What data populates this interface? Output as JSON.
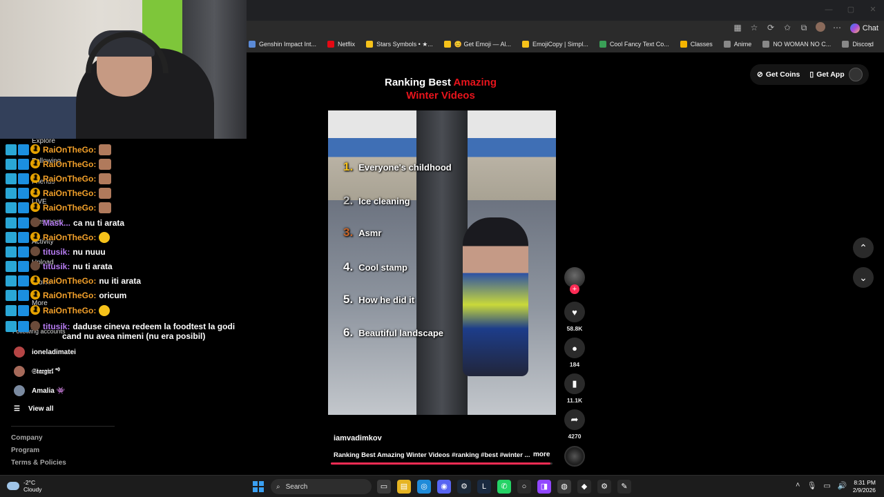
{
  "bookmarks": [
    {
      "label": "Genshin Impact Int...",
      "color": "#5b8ad6"
    },
    {
      "label": "Netflix",
      "color": "#e50914"
    },
    {
      "label": "Stars Symbols • ★...",
      "color": "#f6c21a"
    },
    {
      "label": "😊 Get Emoji — Al...",
      "color": "#f6c21a"
    },
    {
      "label": "EmojiCopy | Simpl...",
      "color": "#f6c21a"
    },
    {
      "label": "Cool Fancy Text Co...",
      "color": "#3aa057"
    },
    {
      "label": "Classes",
      "color": "#f4b400"
    },
    {
      "label": "Anime",
      "color": "#888888"
    },
    {
      "label": "NO WOMAN NO C...",
      "color": "#888888"
    },
    {
      "label": "Discord",
      "color": "#888888"
    }
  ],
  "browser": {
    "chat_label": "Chat",
    "more_bookmarks_icon": "chevron-right-icon"
  },
  "chat": [
    {
      "user": "RaiOnTheGo:",
      "color": "#f2a02a",
      "text": "",
      "emote": "brown"
    },
    {
      "user": "RaiOnTheGo:",
      "color": "#f2a02a",
      "text": "",
      "emote": "brown"
    },
    {
      "user": "RaiOnTheGo:",
      "color": "#f2a02a",
      "text": "",
      "emote": "brown"
    },
    {
      "user": "RaiOnTheGo:",
      "color": "#f2a02a",
      "text": "",
      "emote": "brown"
    },
    {
      "user": "RaiOnTheGo:",
      "color": "#f2a02a",
      "text": "",
      "emote": "brown"
    },
    {
      "user": "Mask...",
      "color": "#b67cf2",
      "text": "ca nu ti arata",
      "emote": ""
    },
    {
      "user": "RaiOnTheGo:",
      "color": "#f2a02a",
      "text": "",
      "emote": "yellow"
    },
    {
      "user": "titusik:",
      "color": "#b67cf2",
      "text": "nu nuuu",
      "emote": ""
    },
    {
      "user": "titusik:",
      "color": "#b67cf2",
      "text": "nu ti arata",
      "emote": ""
    },
    {
      "user": "RaiOnTheGo:",
      "color": "#f2a02a",
      "text": "nu iti arata",
      "emote": ""
    },
    {
      "user": "RaiOnTheGo:",
      "color": "#f2a02a",
      "text": "oricum",
      "emote": ""
    },
    {
      "user": "RaiOnTheGo:",
      "color": "#f2a02a",
      "text": "",
      "emote": "yellow"
    },
    {
      "user": "titusik:",
      "color": "#b67cf2",
      "text": "daduse cineva redeem la foodtest la godi",
      "emote": ""
    }
  ],
  "chat_continuation": "cand nu avea nimeni (nu era posibil)",
  "sidebar": {
    "nav": [
      "Explore",
      "Following",
      "Friends",
      "LIVE",
      "Messages",
      "Activity",
      "Upload",
      "Profile",
      "More"
    ],
    "following_label": "Following accounts",
    "accounts": [
      {
        "name": "ioneladimatei",
        "color": "#b54545"
      },
      {
        "name": "𝔖𝔱𝔞𝔯𝔤𝔦𝔯𝔩 ⁺⁰",
        "color": "#a66a5a"
      },
      {
        "name": "Amalia 👾",
        "color": "#7a8aa0"
      }
    ],
    "view_all": "View all",
    "footer": [
      "Company",
      "Program",
      "Terms & Policies"
    ]
  },
  "video": {
    "title_part1": "Ranking Best",
    "title_red1": "Amazing",
    "title_red2": "Winter Videos",
    "rankings": [
      {
        "num": "1.",
        "label": "Everyone's childhood",
        "color": "#f6c21a"
      },
      {
        "num": "2.",
        "label": "Ice cleaning",
        "color": "#c0c0c0"
      },
      {
        "num": "3.",
        "label": "Asmr",
        "color": "#c8662a"
      },
      {
        "num": "4.",
        "label": "Cool stamp",
        "color": "#ffffff"
      },
      {
        "num": "5.",
        "label": "How he did it",
        "color": "#ffffff"
      },
      {
        "num": "6.",
        "label": "Beautiful landscape",
        "color": "#ffffff"
      }
    ],
    "author": "iamvadimkov",
    "caption": "Ranking Best Amazing Winter Videos #ranking #best #winter ...",
    "more": "more",
    "progress": 0.99
  },
  "actions": {
    "likes": "58.8K",
    "comments": "184",
    "saves": "11.1K",
    "shares": "4270"
  },
  "topbar": {
    "coins": "Get Coins",
    "app": "Get App"
  },
  "taskbar": {
    "temp": "-2°C",
    "weather": "Cloudy",
    "search": "Search",
    "time": "8:31 PM",
    "date": "2/9/2026"
  }
}
